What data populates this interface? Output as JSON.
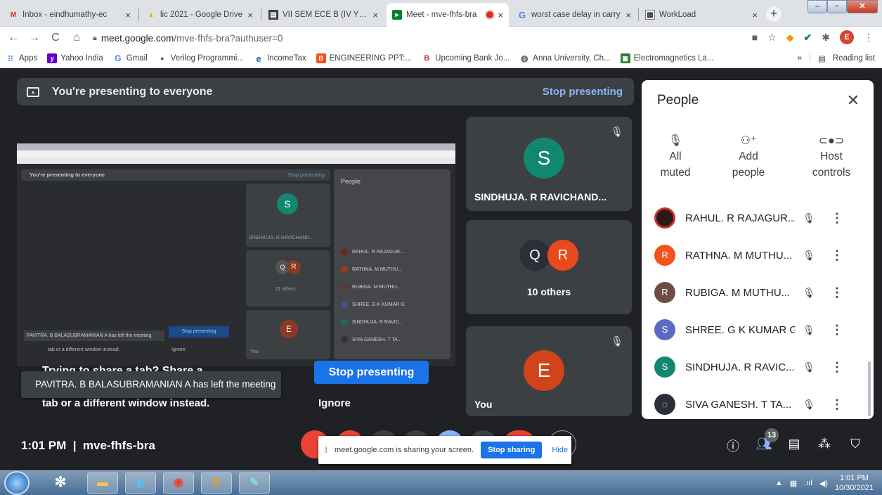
{
  "browser": {
    "tabs": [
      {
        "title": "Inbox - eindhumathy-ec",
        "icon": "gmail-icon"
      },
      {
        "title": "lic 2021 - Google Drive",
        "icon": "drive-icon"
      },
      {
        "title": "VII SEM ECE B (IV YEAR)",
        "icon": "sheet-icon"
      },
      {
        "title": "Meet - mve-fhfs-bra",
        "icon": "meet-icon"
      },
      {
        "title": "worst case delay in carry",
        "icon": "google-icon"
      },
      {
        "title": "WorkLoad",
        "icon": "sheet-icon"
      }
    ],
    "url_host": "meet.google.com",
    "url_path": "/mve-fhfs-bra?authuser=0",
    "profile_initial": "E",
    "bookmarks": [
      "Apps",
      "Yahoo India",
      "Gmail",
      "Verilog Programmi...",
      "IncomeTax",
      "ENGINEERING PPT:...",
      "Upcoming Bank Jo...",
      "Anna University, Ch...",
      "Electromagnetics La..."
    ],
    "bookmarks_more": "»",
    "reading_list": "Reading list"
  },
  "meet": {
    "banner_text": "You're presenting to everyone",
    "banner_stop": "Stop presenting",
    "prompt_title": "Trying to share a tab? Share a",
    "prompt_sub": "tab or a different window instead.",
    "prompt_a": "a",
    "stop_button": "Stop presenting",
    "ignore_button": "Ignore",
    "toast": "PAVITRA. B BALASUBRAMANIAN A has left the meeting",
    "tiles": [
      {
        "name": "SINDHUJA. R RAVICHAND...",
        "initial": "S",
        "color": "#12876f"
      },
      {
        "name": "10 others",
        "initial": "R",
        "color": "#e8491d"
      },
      {
        "name": "You",
        "initial": "E",
        "color": "#d0431b"
      }
    ],
    "meeting_time": "1:01 PM",
    "meeting_code": "mve-fhfs-bra",
    "participant_count": "13",
    "share_bar_text": "meet.google.com is sharing your screen.",
    "share_bar_stop": "Stop sharing",
    "share_bar_hide": "Hide"
  },
  "people": {
    "title": "People",
    "actions": [
      {
        "line1": "All",
        "line2": "muted",
        "icon": "mic-off-icon"
      },
      {
        "line1": "Add",
        "line2": "people",
        "icon": "add-person-icon"
      },
      {
        "line1": "Host",
        "line2": "controls",
        "icon": "toggle-icon"
      }
    ],
    "list": [
      {
        "name": "RAHUL. R RAJAGUR...",
        "initial": "R",
        "color": "#2a1a1a"
      },
      {
        "name": "RATHNA. M MUTHU...",
        "initial": "R",
        "color": "#f4511e"
      },
      {
        "name": "RUBIGA. M MUTHU...",
        "initial": "R",
        "color": "#6d4c41"
      },
      {
        "name": "SHREE. G K KUMAR G",
        "initial": "S",
        "color": "#5c6bc0"
      },
      {
        "name": "SINDHUJA. R RAVIC...",
        "initial": "S",
        "color": "#12876f"
      },
      {
        "name": "SIVA GANESH. T TA...",
        "initial": "",
        "color": "#2b2f3a"
      }
    ]
  },
  "preview": {
    "banner": "You're presenting to everyone",
    "stop": "Stop presenting",
    "people": "People",
    "s_name": "SINDHUJA. R RAVICHAND...",
    "others": "11 others",
    "you": "You",
    "toast": "PAVITRA. B BALASUBRAMANIAN A has left the meeting",
    "sub": "tab or a different window instead.",
    "ignore": "Ignore",
    "stop_btn": "Stop presenting",
    "rows": [
      "RAHUL. R RAJAGUR...",
      "RATHNA. M MUTHU...",
      "RUBIGA. M MUTHU...",
      "SHREE. G K KUMAR G",
      "SINDHUJA. R RAVIC...",
      "SIVA GANESH. T TA..."
    ]
  },
  "taskbar": {
    "time": "1:01 PM",
    "date": "10/30/2021"
  }
}
